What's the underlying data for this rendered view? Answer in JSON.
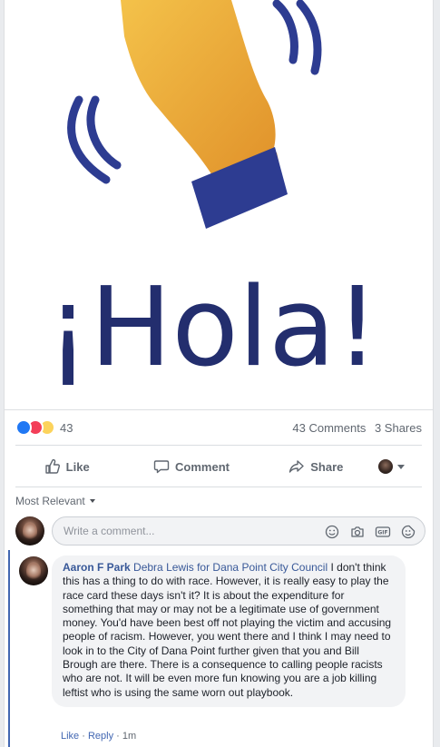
{
  "post": {
    "image_text": "¡Hola!",
    "reaction_count": "43",
    "comments_count": "43 Comments",
    "shares_count": "3 Shares"
  },
  "actions": {
    "like": "Like",
    "comment": "Comment",
    "share": "Share"
  },
  "comments_section": {
    "sort_label": "Most Relevant",
    "compose_placeholder": "Write a comment..."
  },
  "comment": {
    "author": "Aaron F Park",
    "mention": "Debra Lewis for Dana Point City Council",
    "text": " I don't think this has a thing to do with race. However, it is really easy to play the race card these days isn't it? It is about the expenditure for something that may or may not be a legitimate use of government money. You'd have been best off not playing the victim and accusing people of racism. However, you went there and I think I may need to look in to the City of Dana Point further given that you and Bill Brough are there. There is a consequence to calling people racists who are not. It will be even more fun knowing you are a job killing leftist who is using the same worn out playbook.",
    "like_label": "Like",
    "separator": "·",
    "reply_label": "Reply",
    "time": "1m"
  },
  "colors": {
    "hand_yellow": "#f2b53a",
    "hand_orange": "#e39a2a",
    "cuff_blue": "#2f3f95",
    "text_navy": "#232e6e",
    "link_blue": "#385898"
  }
}
